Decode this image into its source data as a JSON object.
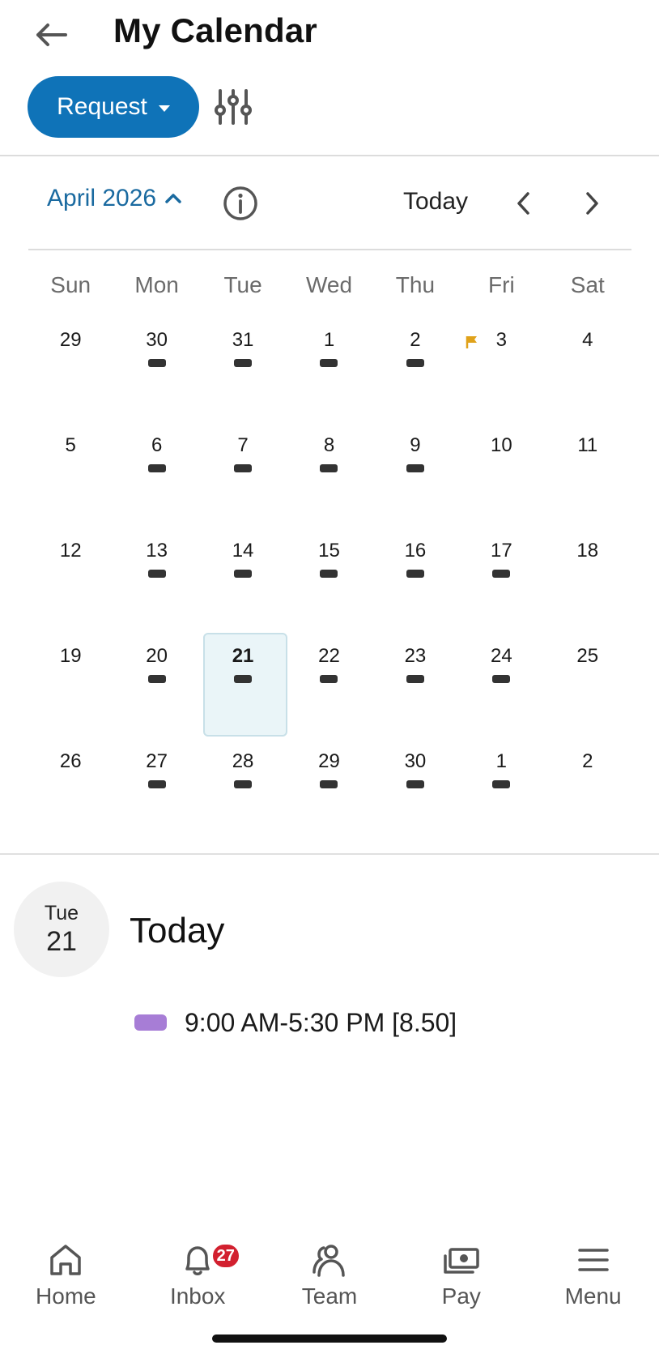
{
  "header": {
    "title": "My Calendar"
  },
  "toolbar": {
    "request_label": "Request"
  },
  "calendar": {
    "month_label": "April 2026",
    "today_label": "Today",
    "weekdays": [
      "Sun",
      "Mon",
      "Tue",
      "Wed",
      "Thu",
      "Fri",
      "Sat"
    ],
    "weeks": [
      [
        {
          "d": "29",
          "shift": false
        },
        {
          "d": "30",
          "shift": true
        },
        {
          "d": "31",
          "shift": true
        },
        {
          "d": "1",
          "shift": true
        },
        {
          "d": "2",
          "shift": true
        },
        {
          "d": "3",
          "shift": false,
          "flag": true
        },
        {
          "d": "4",
          "shift": false
        }
      ],
      [
        {
          "d": "5",
          "shift": false
        },
        {
          "d": "6",
          "shift": true
        },
        {
          "d": "7",
          "shift": true
        },
        {
          "d": "8",
          "shift": true
        },
        {
          "d": "9",
          "shift": true
        },
        {
          "d": "10",
          "shift": false
        },
        {
          "d": "11",
          "shift": false
        }
      ],
      [
        {
          "d": "12",
          "shift": false
        },
        {
          "d": "13",
          "shift": true
        },
        {
          "d": "14",
          "shift": true
        },
        {
          "d": "15",
          "shift": true
        },
        {
          "d": "16",
          "shift": true
        },
        {
          "d": "17",
          "shift": true
        },
        {
          "d": "18",
          "shift": false
        }
      ],
      [
        {
          "d": "19",
          "shift": false
        },
        {
          "d": "20",
          "shift": true
        },
        {
          "d": "21",
          "shift": true,
          "selected": true
        },
        {
          "d": "22",
          "shift": true
        },
        {
          "d": "23",
          "shift": true
        },
        {
          "d": "24",
          "shift": true
        },
        {
          "d": "25",
          "shift": false
        }
      ],
      [
        {
          "d": "26",
          "shift": false
        },
        {
          "d": "27",
          "shift": true
        },
        {
          "d": "28",
          "shift": true
        },
        {
          "d": "29",
          "shift": true
        },
        {
          "d": "30",
          "shift": true
        },
        {
          "d": "1",
          "shift": true
        },
        {
          "d": "2",
          "shift": false
        }
      ]
    ],
    "colors": {
      "shift_marker": "#333333",
      "holiday_flag": "#e0a21a",
      "selected_bg": "#eaf5f8",
      "accent": "#0f73b8"
    }
  },
  "today": {
    "dow": "Tue",
    "day": "21",
    "label": "Today",
    "shift_text": "9:00 AM-5:30 PM [8.50]",
    "shift_color": "#a77dd6"
  },
  "bottom_nav": {
    "items": [
      {
        "label": "Home",
        "icon": "home-icon"
      },
      {
        "label": "Inbox",
        "icon": "bell-icon",
        "badge": "27"
      },
      {
        "label": "Team",
        "icon": "team-icon"
      },
      {
        "label": "Pay",
        "icon": "pay-icon"
      },
      {
        "label": "Menu",
        "icon": "menu-icon"
      }
    ]
  }
}
